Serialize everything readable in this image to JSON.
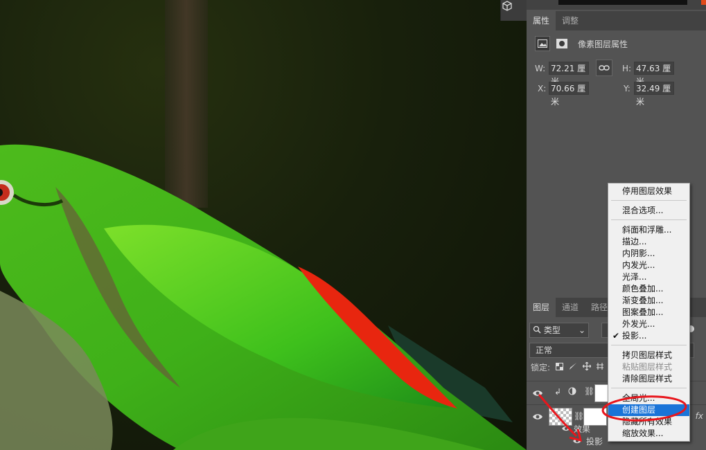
{
  "properties_panel": {
    "tabs": [
      "属性",
      "调整"
    ],
    "title": "像素图层属性",
    "w_label": "W:",
    "w_value": "72.21 厘米",
    "h_label": "H:",
    "h_value": "47.63 厘米",
    "x_label": "X:",
    "x_value": "70.66 厘米",
    "y_label": "Y:",
    "y_value": "32.49 厘米"
  },
  "layers_panel": {
    "tabs": [
      "图层",
      "通道",
      "路径"
    ],
    "filter_label": "类型",
    "blend_mode": "正常",
    "lock_label": "锁定:",
    "effects_label": "效果",
    "drop_shadow_label": "投影",
    "fx_label": "fx"
  },
  "context_menu": {
    "items": [
      {
        "label": "停用图层效果",
        "state": "normal"
      },
      {
        "label": "混合选项...",
        "state": "normal"
      },
      {
        "label": "斜面和浮雕...",
        "state": "normal"
      },
      {
        "label": "描边...",
        "state": "normal"
      },
      {
        "label": "内阴影...",
        "state": "normal"
      },
      {
        "label": "内发光...",
        "state": "normal"
      },
      {
        "label": "光泽...",
        "state": "normal"
      },
      {
        "label": "颜色叠加...",
        "state": "normal"
      },
      {
        "label": "渐变叠加...",
        "state": "normal"
      },
      {
        "label": "图案叠加...",
        "state": "normal"
      },
      {
        "label": "外发光...",
        "state": "normal"
      },
      {
        "label": "投影...",
        "state": "checked"
      },
      {
        "label": "拷贝图层样式",
        "state": "normal"
      },
      {
        "label": "粘贴图层样式",
        "state": "disabled"
      },
      {
        "label": "清除图层样式",
        "state": "normal"
      },
      {
        "label": "全局光...",
        "state": "normal"
      },
      {
        "label": "创建图层",
        "state": "highlighted"
      },
      {
        "label": "隐藏所有效果",
        "state": "normal"
      },
      {
        "label": "缩放效果...",
        "state": "normal"
      }
    ],
    "highlight_color": "#1a74d8"
  },
  "icons": {
    "cube": "3d-cube-icon",
    "image": "image-icon",
    "mask": "mask-icon",
    "link": "link-icon",
    "search": "search-icon",
    "eye": "eye-icon",
    "check": "checkmark-icon"
  },
  "colors": {
    "annotation": "#e8161c",
    "panel_bg": "#535353",
    "field_bg": "#414141"
  }
}
